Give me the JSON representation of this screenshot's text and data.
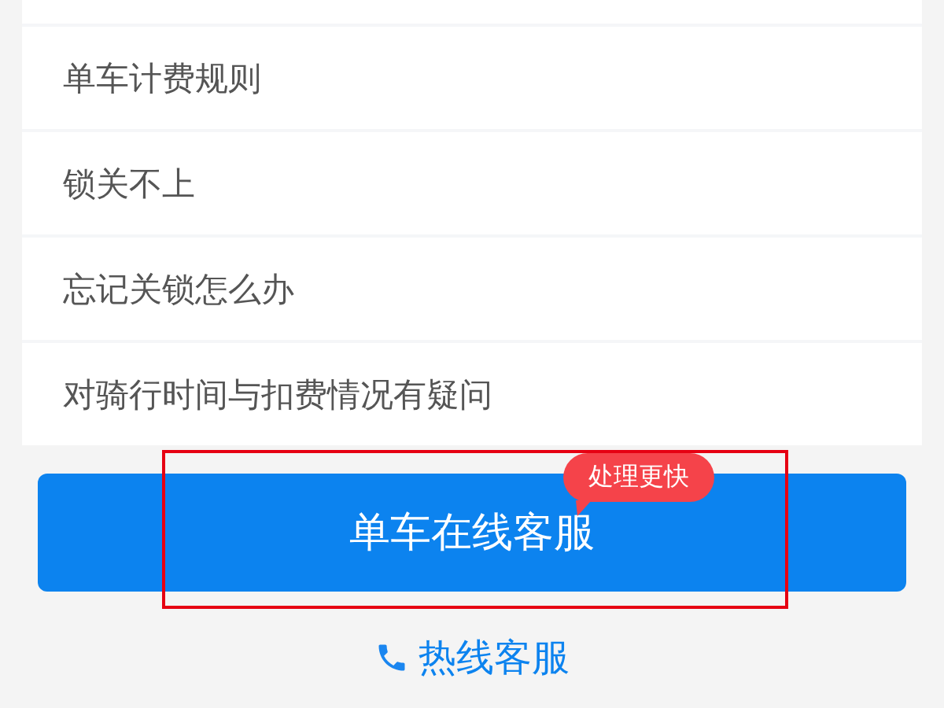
{
  "faq_items": [
    {
      "label": "单车计费规则"
    },
    {
      "label": "锁关不上"
    },
    {
      "label": "忘记关锁怎么办"
    },
    {
      "label": "对骑行时间与扣费情况有疑问"
    }
  ],
  "online_service": {
    "label": "单车在线客服",
    "badge": "处理更快",
    "highlighted": true
  },
  "hotline": {
    "label": "热线客服"
  }
}
